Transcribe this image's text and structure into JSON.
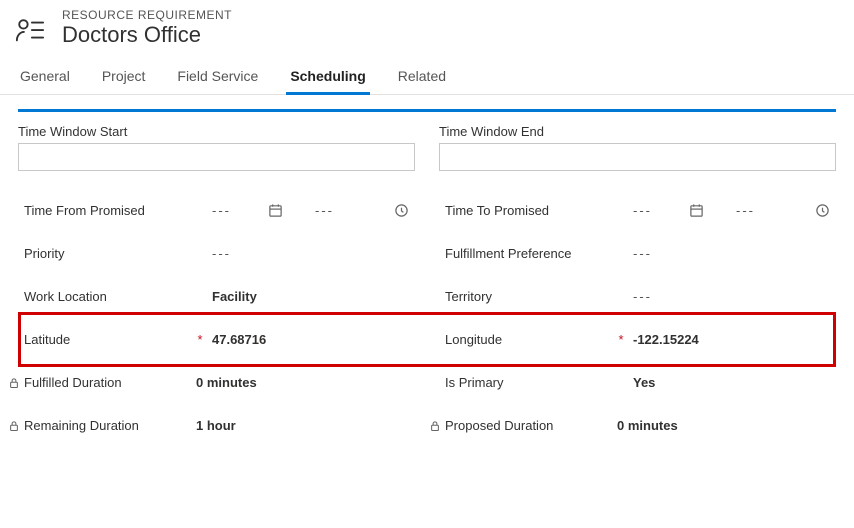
{
  "header": {
    "super": "RESOURCE REQUIREMENT",
    "title": "Doctors Office"
  },
  "tabs": [
    {
      "label": "General",
      "active": false
    },
    {
      "label": "Project",
      "active": false
    },
    {
      "label": "Field Service",
      "active": false
    },
    {
      "label": "Scheduling",
      "active": true
    },
    {
      "label": "Related",
      "active": false
    }
  ],
  "sections": {
    "left": {
      "label": "Time Window Start",
      "value": ""
    },
    "right": {
      "label": "Time Window End",
      "value": ""
    }
  },
  "left_fields": {
    "time_from_promised": {
      "label": "Time From Promised",
      "date": "---",
      "time": "---"
    },
    "priority": {
      "label": "Priority",
      "value": "---"
    },
    "work_location": {
      "label": "Work Location",
      "value": "Facility"
    },
    "latitude": {
      "label": "Latitude",
      "required": true,
      "value": "47.68716"
    },
    "fulfilled_duration": {
      "label": "Fulfilled Duration",
      "value": "0 minutes",
      "locked": true
    },
    "remaining_duration": {
      "label": "Remaining Duration",
      "value": "1 hour",
      "locked": true
    }
  },
  "right_fields": {
    "time_to_promised": {
      "label": "Time To Promised",
      "date": "---",
      "time": "---"
    },
    "fulfillment_preference": {
      "label": "Fulfillment Preference",
      "value": "---"
    },
    "territory": {
      "label": "Territory",
      "value": "---"
    },
    "longitude": {
      "label": "Longitude",
      "required": true,
      "value": "-122.15224"
    },
    "is_primary": {
      "label": "Is Primary",
      "value": "Yes"
    },
    "proposed_duration": {
      "label": "Proposed Duration",
      "value": "0 minutes",
      "locked": true
    }
  }
}
